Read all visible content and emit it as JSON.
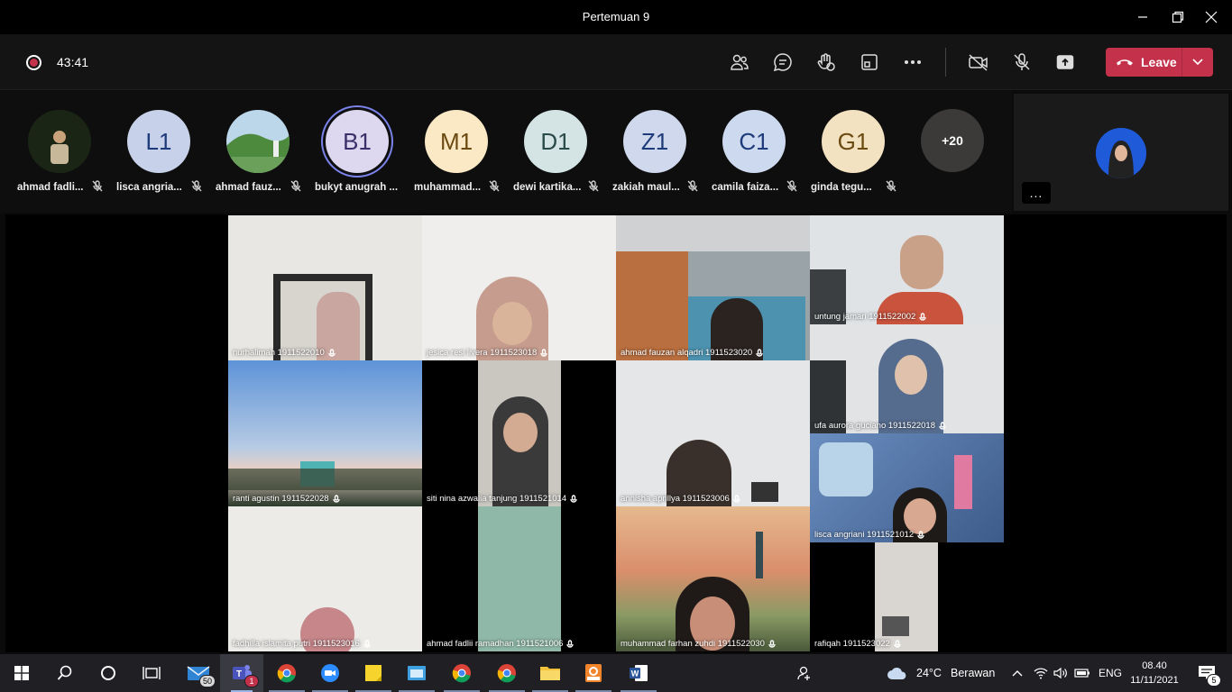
{
  "window": {
    "title": "Pertemuan 9"
  },
  "meeting": {
    "recording_timer": "43:41",
    "leave_label": "Leave",
    "overflow_count": "+20"
  },
  "participants_strip": [
    {
      "name": "ahmad fadli...",
      "initials": "",
      "bg": "#2a3a22"
    },
    {
      "name": "lisca angria...",
      "initials": "L1",
      "bg": "#c7d2ea",
      "fg": "#1d3b7a"
    },
    {
      "name": "ahmad fauz...",
      "initials": "",
      "bg": "#5a8a4a"
    },
    {
      "name": "bukyt anugrah ...",
      "initials": "B1",
      "bg": "#ddd7ef",
      "fg": "#3b2f6a"
    },
    {
      "name": "muhammad...",
      "initials": "M1",
      "bg": "#fbe8c5",
      "fg": "#6a4a10"
    },
    {
      "name": "dewi kartika...",
      "initials": "D1",
      "bg": "#d4e4e4",
      "fg": "#2a4a4a"
    },
    {
      "name": "zakiah maul...",
      "initials": "Z1",
      "bg": "#cfd8ec",
      "fg": "#1d3b7a"
    },
    {
      "name": "camila faiza...",
      "initials": "C1",
      "bg": "#cdd9ee",
      "fg": "#1d3b7a"
    },
    {
      "name": "ginda tegu...",
      "initials": "G1",
      "bg": "#f3e2c2",
      "fg": "#6a4a10"
    }
  ],
  "self_view": {
    "more_label": "..."
  },
  "video_tiles": [
    {
      "name": "nurhalimah  1911522010",
      "bg": "#e9e7e3"
    },
    {
      "name": "jesica resi livera  1911523018",
      "bg": "#efeeec"
    },
    {
      "name": "ahmad fauzan alqadri  1911523020",
      "bg": "#9aa3a8"
    },
    {
      "name": "untung jamari  1911522002",
      "bg": "#dfe3e6"
    },
    {
      "name": "ufa aurora guciano  1911522018",
      "bg": "#e1e3e5"
    },
    {
      "name": "ranti agustin  1911522028",
      "bg": "#7aa7dc"
    },
    {
      "name": "siti nina azwalia tanjung 1911521014",
      "bg": "#000000"
    },
    {
      "name": "annisha aprillya  1911523006",
      "bg": "#e4e6e8"
    },
    {
      "name": "lisca angriani  1911521012",
      "bg": "#4a6a9a"
    },
    {
      "name": "fadhilla islamita putri  1911523016",
      "bg": "#ecebe8"
    },
    {
      "name": "ahmad fadlii ramadhan  1911521006",
      "bg": "#000000"
    },
    {
      "name": "muhammad farhan zuhdi  1911522030",
      "bg": "#d9a776"
    },
    {
      "name": "rafiqah  1911523022",
      "bg": "#000000"
    }
  ],
  "taskbar": {
    "mail_badge": "50",
    "teams_badge": "1",
    "temperature": "24°C",
    "weather": "Berawan",
    "language": "ENG",
    "time": "08.40",
    "date": "11/11/2021",
    "notifications": "5"
  }
}
